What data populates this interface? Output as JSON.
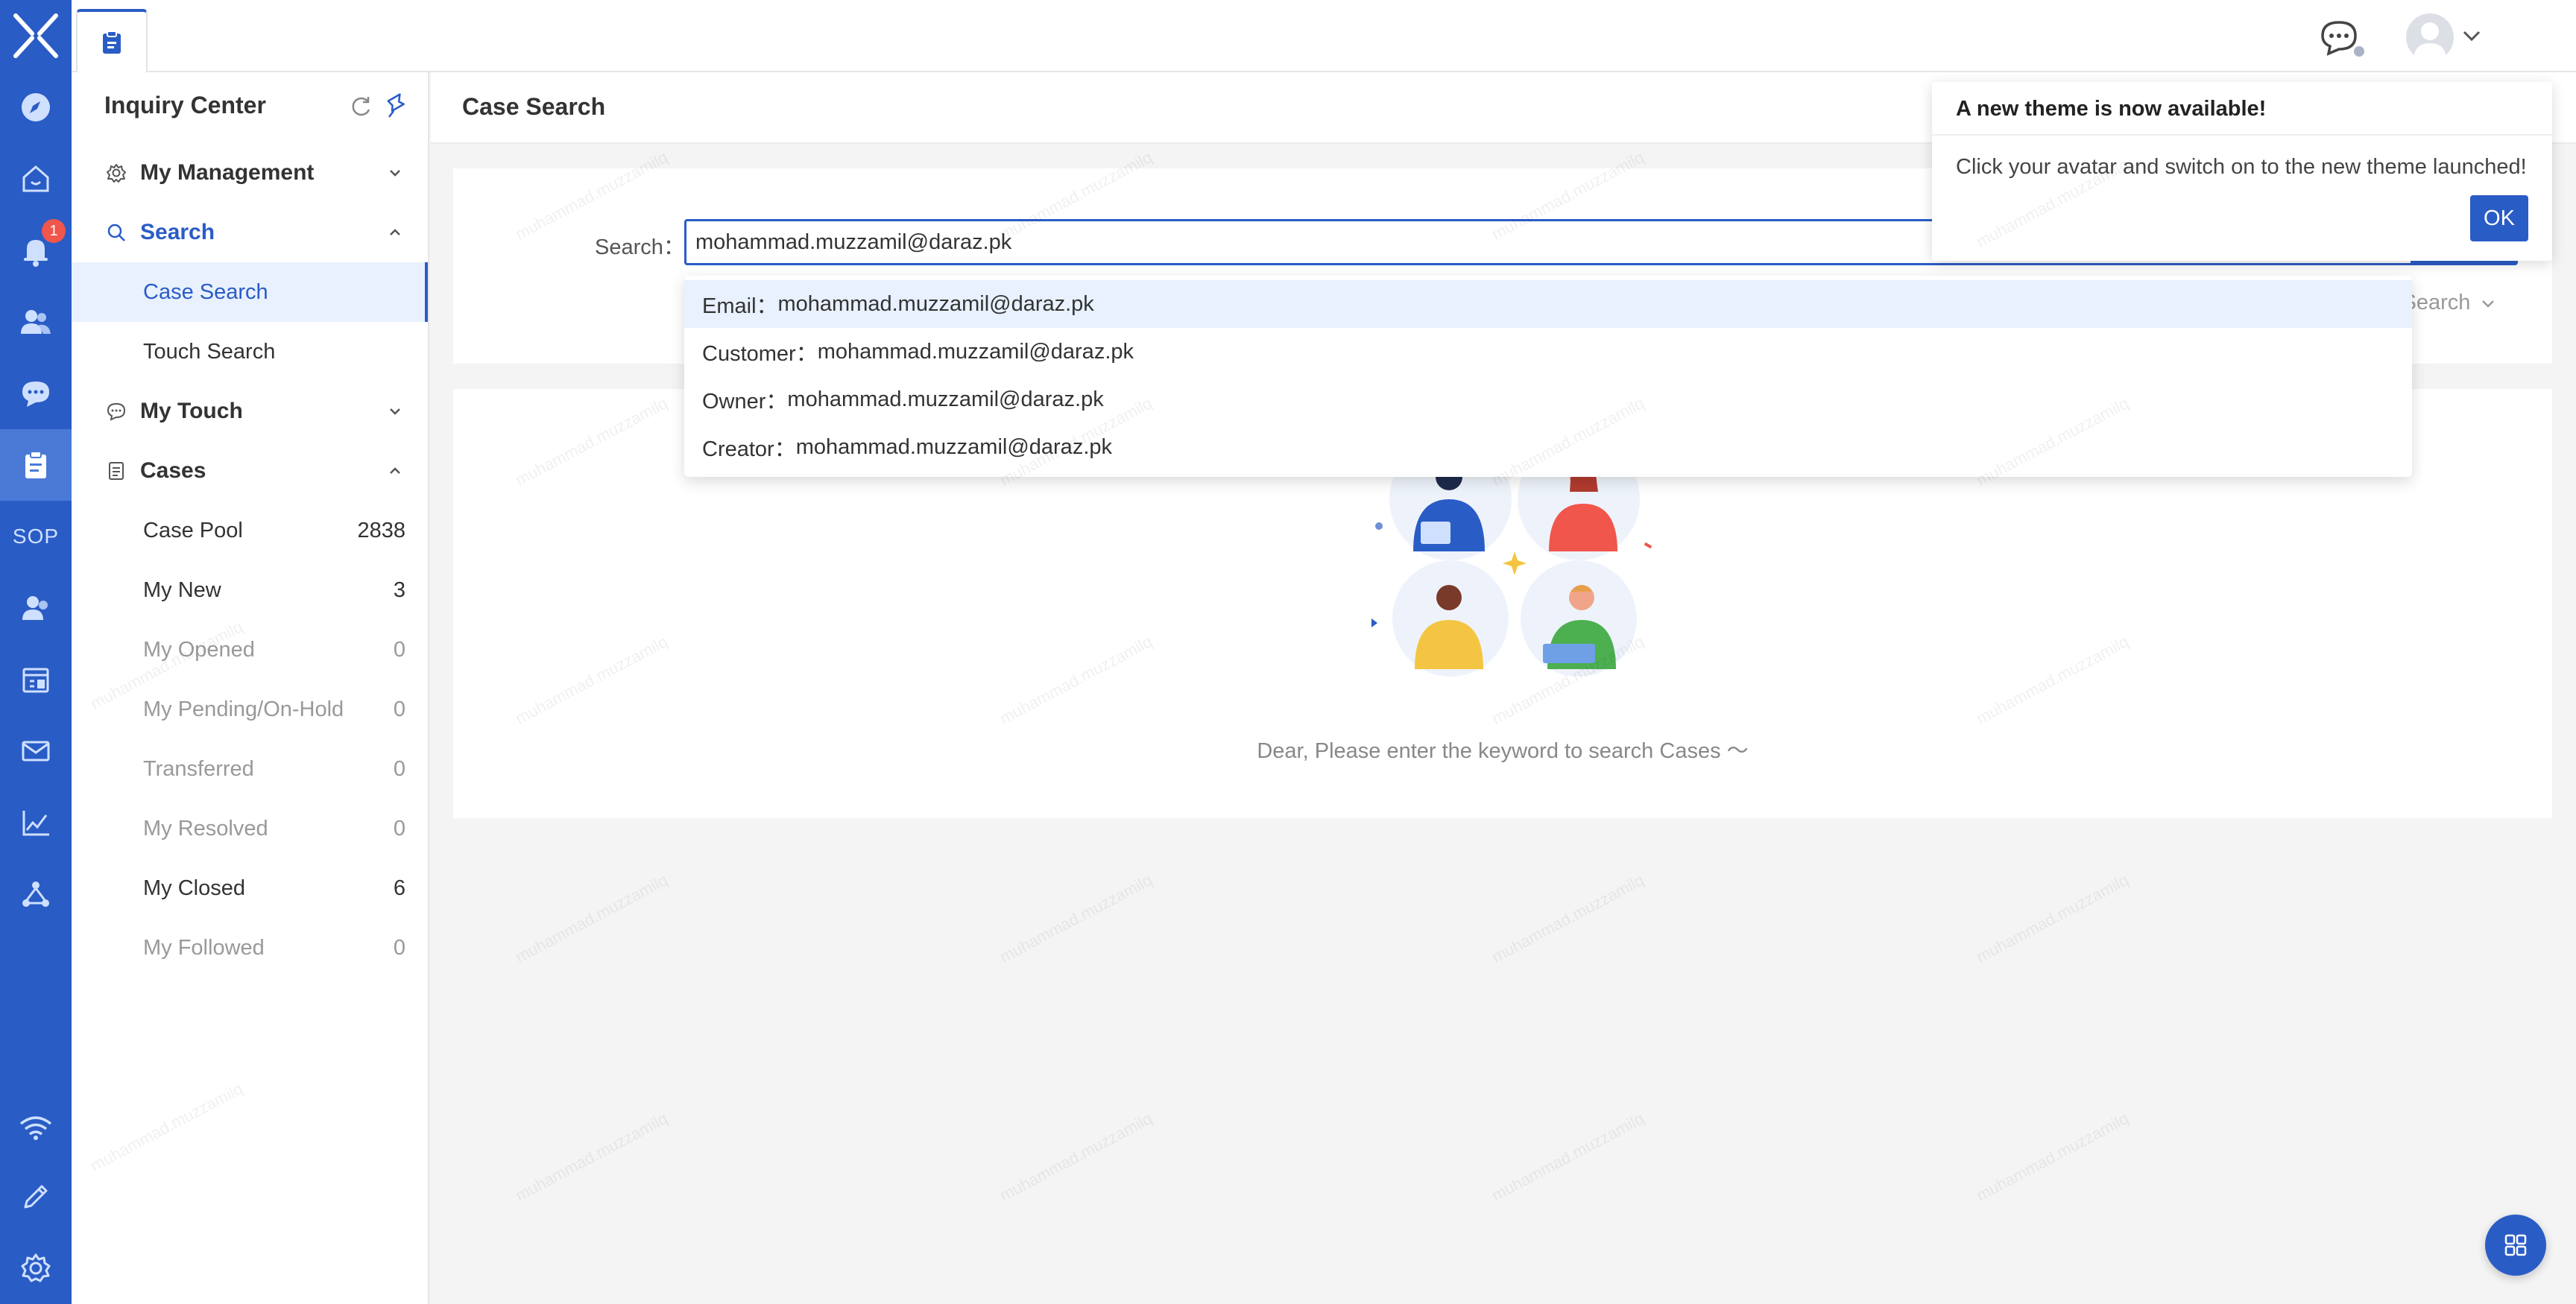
{
  "watermark": "muhammad.muzzamilq",
  "rail": {
    "notification_badge": "1",
    "sop_label": "SOP",
    "items": [
      "explore-icon",
      "home-icon",
      "bell-icon",
      "users-icon",
      "chat-icon",
      "clipboard-icon",
      "sop-icon",
      "contacts-icon",
      "calendar-icon",
      "mail-icon",
      "analytics-icon",
      "network-icon",
      "wifi-icon",
      "pencil-icon",
      "gear-icon"
    ]
  },
  "sidebar": {
    "title": "Inquiry Center",
    "sections": {
      "management": "My Management",
      "search": "Search",
      "touch": "My Touch",
      "cases": "Cases"
    },
    "search_items": {
      "case_search": "Case Search",
      "touch_search": "Touch Search"
    },
    "cases": [
      {
        "label": "Case Pool",
        "count": "2838"
      },
      {
        "label": "My New",
        "count": "3"
      },
      {
        "label": "My Opened",
        "count": "0"
      },
      {
        "label": "My Pending/On-Hold",
        "count": "0"
      },
      {
        "label": "Transferred",
        "count": "0"
      },
      {
        "label": "My Resolved",
        "count": "0"
      },
      {
        "label": "My Closed",
        "count": "6"
      },
      {
        "label": "My Followed",
        "count": "0"
      }
    ]
  },
  "main": {
    "page_title": "Case Search",
    "search_label": "Search：",
    "search_value": "mohammad.muzzamil@daraz.pk",
    "advanced_search": "l Search",
    "empty_message": "Dear, Please enter the keyword to search Cases ～"
  },
  "dropdown": [
    {
      "field": "Email：",
      "value": "mohammad.muzzamil@daraz.pk"
    },
    {
      "field": "Customer：",
      "value": "mohammad.muzzamil@daraz.pk"
    },
    {
      "field": "Owner：",
      "value": "mohammad.muzzamil@daraz.pk"
    },
    {
      "field": "Creator：",
      "value": "mohammad.muzzamil@daraz.pk"
    }
  ],
  "popup": {
    "title": "A new theme is now available!",
    "body": "Click your avatar and switch on to the new theme launched!",
    "ok": "OK"
  },
  "colors": {
    "brand": "#2a5cc6",
    "badge": "#f0564b",
    "active_bg": "#e8f1fd"
  }
}
